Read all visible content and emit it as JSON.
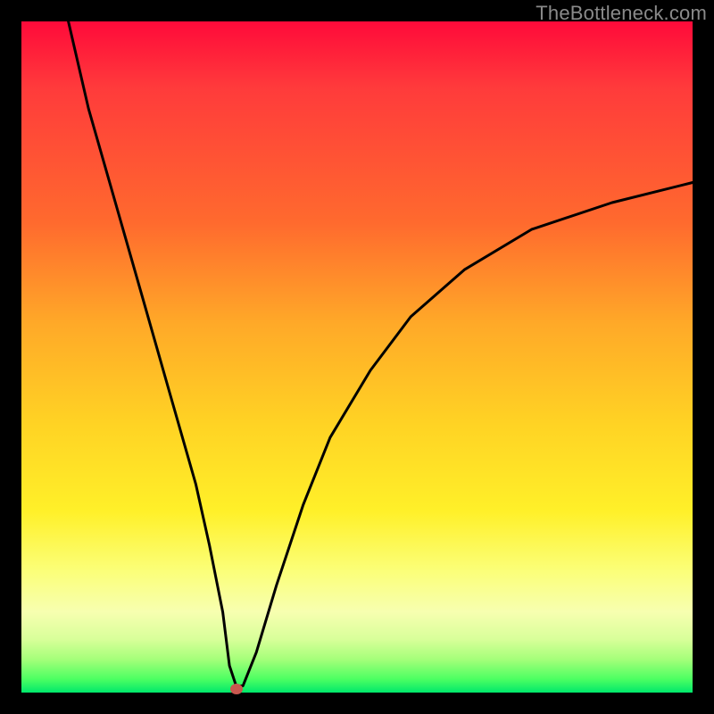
{
  "attribution": "TheBottleneck.com",
  "chart_data": {
    "type": "line",
    "title": "",
    "xlabel": "",
    "ylabel": "",
    "xlim": [
      0,
      100
    ],
    "ylim": [
      0,
      100
    ],
    "grid": false,
    "legend": false,
    "series": [
      {
        "name": "bottleneck-curve",
        "x": [
          7,
          10,
          14,
          18,
          22,
          26,
          28,
          30,
          31,
          32,
          33,
          35,
          38,
          42,
          46,
          52,
          58,
          66,
          76,
          88,
          100
        ],
        "y": [
          100,
          87,
          73,
          59,
          45,
          31,
          22,
          12,
          4,
          1,
          1,
          6,
          16,
          28,
          38,
          48,
          56,
          63,
          69,
          73,
          76
        ]
      }
    ],
    "annotations": [
      {
        "name": "min-marker",
        "x": 32,
        "y": 0.5,
        "color": "#c9574f"
      }
    ],
    "background_gradient": {
      "direction": "vertical",
      "stops": [
        {
          "pos": 0,
          "color": "#ff0a3a"
        },
        {
          "pos": 30,
          "color": "#ff6a2e"
        },
        {
          "pos": 60,
          "color": "#ffd324"
        },
        {
          "pos": 85,
          "color": "#fbff7a"
        },
        {
          "pos": 100,
          "color": "#00e86b"
        }
      ]
    }
  }
}
